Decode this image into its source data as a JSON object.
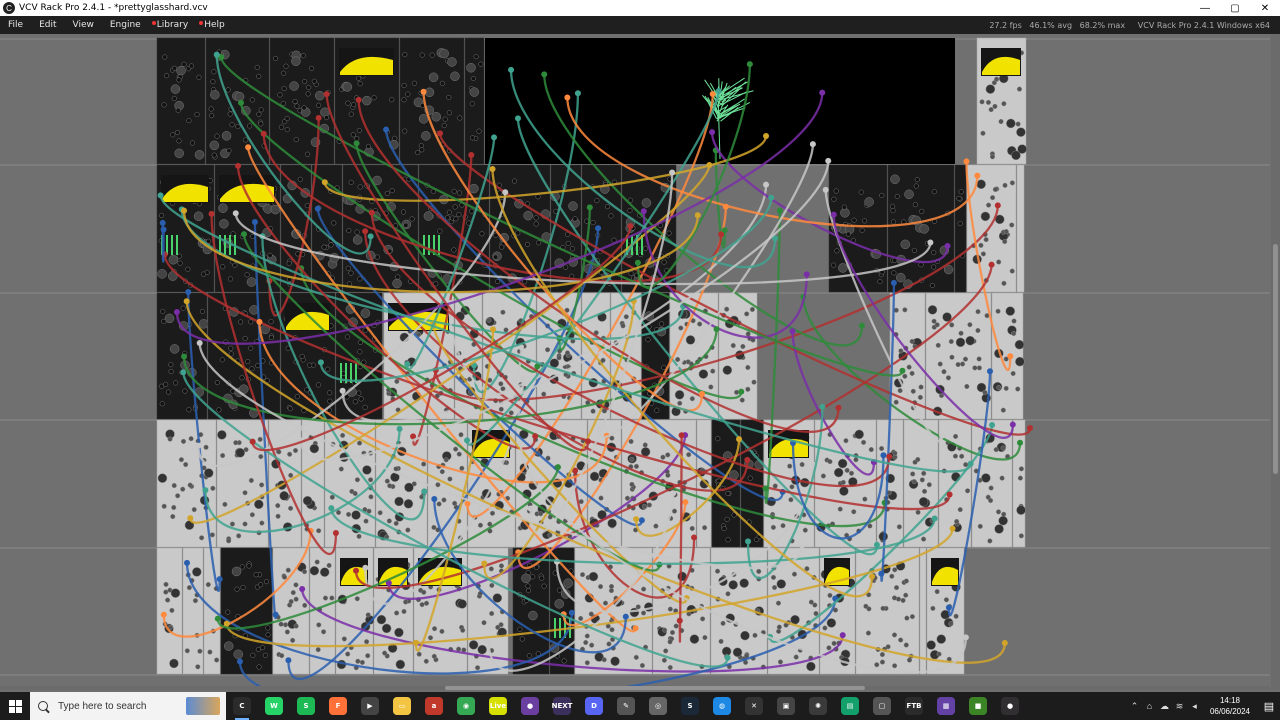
{
  "window": {
    "title": "VCV Rack Pro 2.4.1 - *prettyglasshard.vcv",
    "app_icon_glyph": "C",
    "controls": {
      "minimize": "—",
      "maximize": "▢",
      "close": "✕"
    }
  },
  "menubar": {
    "items": [
      {
        "label": "File",
        "dot": false
      },
      {
        "label": "Edit",
        "dot": false
      },
      {
        "label": "View",
        "dot": false
      },
      {
        "label": "Engine",
        "dot": false
      },
      {
        "label": "Library",
        "dot": true
      },
      {
        "label": "Help",
        "dot": true
      }
    ],
    "status": "27.2 fps   46.1% avg   68.2% max     VCV Rack Pro 2.4.1 Windows x64"
  },
  "colors": {
    "rack_bg": "#707070",
    "panel_dark": "#1b1b1b",
    "panel_light": "#c9c9c9",
    "scope_yellow": "#f2e200",
    "cable_colors": [
      "#2e8b3a",
      "#7a2ea8",
      "#d2a52a",
      "#2a5fb0",
      "#b33030",
      "#3fa38f",
      "#c7c7c7",
      "#ff8a3d"
    ]
  },
  "taskbar": {
    "search_placeholder": "Type here to search",
    "apps": [
      {
        "name": "vcv-rack-icon",
        "label": "C",
        "color": "#2b2b2b",
        "active": true
      },
      {
        "name": "whatsapp-icon",
        "label": "W",
        "color": "#25d366",
        "active": false
      },
      {
        "name": "spotify-icon",
        "label": "S",
        "color": "#1db954",
        "active": false
      },
      {
        "name": "firefox-icon",
        "label": "F",
        "color": "#ff7139",
        "active": false
      },
      {
        "name": "media-player-icon",
        "label": "▶",
        "color": "#444444",
        "active": false
      },
      {
        "name": "file-explorer-icon",
        "label": "▭",
        "color": "#f4c542",
        "active": false
      },
      {
        "name": "app-red-icon",
        "label": "a",
        "color": "#c0392b",
        "active": false
      },
      {
        "name": "chrome-icon",
        "label": "◉",
        "color": "#34a853",
        "active": false
      },
      {
        "name": "ableton-live-icon",
        "label": "Live",
        "color": "#d6e000",
        "active": false
      },
      {
        "name": "app-purple-icon",
        "label": "●",
        "color": "#6a3fa0",
        "active": false
      },
      {
        "name": "next-app-icon",
        "label": "NEXT",
        "color": "#3b2f5c",
        "active": false
      },
      {
        "name": "discord-icon",
        "label": "D",
        "color": "#5865f2",
        "active": false
      },
      {
        "name": "app-tools-icon",
        "label": "✎",
        "color": "#555555",
        "active": false
      },
      {
        "name": "app-circle-icon",
        "label": "◎",
        "color": "#666666",
        "active": false
      },
      {
        "name": "steam-icon",
        "label": "S",
        "color": "#1b2838",
        "active": false
      },
      {
        "name": "app-blue-icon",
        "label": "◍",
        "color": "#1e88e5",
        "active": false
      },
      {
        "name": "app-x-icon",
        "label": "✕",
        "color": "#333333",
        "active": false
      },
      {
        "name": "app-cube-icon",
        "label": "▣",
        "color": "#444444",
        "active": false
      },
      {
        "name": "app-gear-icon",
        "label": "✺",
        "color": "#3a3a3a",
        "active": false
      },
      {
        "name": "app-green-icon",
        "label": "▤",
        "color": "#14a06b",
        "active": false
      },
      {
        "name": "app-box-icon",
        "label": "▢",
        "color": "#555555",
        "active": false
      },
      {
        "name": "ftb-icon",
        "label": "FTB",
        "color": "#2b2b2b",
        "active": false
      },
      {
        "name": "twitch-icon",
        "label": "▦",
        "color": "#6441a5",
        "active": false
      },
      {
        "name": "minecraft-icon",
        "label": "■",
        "color": "#3c8527",
        "active": false
      },
      {
        "name": "obs-icon",
        "label": "●",
        "color": "#302e31",
        "active": false
      }
    ],
    "tray": {
      "icons": [
        "chevron-up-icon",
        "network-icon",
        "cloud-icon",
        "wifi-icon",
        "speaker-icon"
      ],
      "time": "14:18",
      "date": "06/06/2024"
    }
  }
}
